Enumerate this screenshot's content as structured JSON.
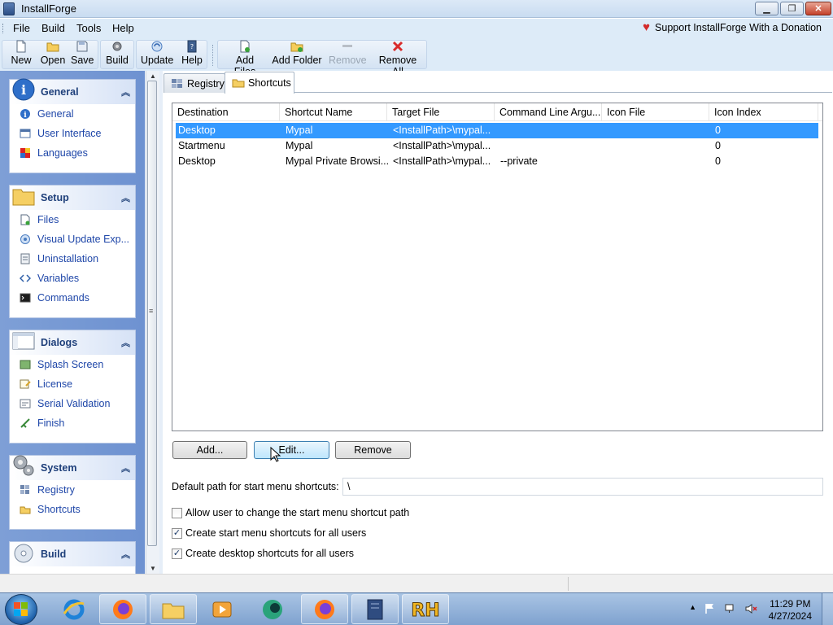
{
  "window": {
    "title": "InstallForge"
  },
  "menu": {
    "items": [
      "File",
      "Build",
      "Tools",
      "Help"
    ],
    "donation": "Support InstallForge With a Donation"
  },
  "toolbar": {
    "new": "New",
    "open": "Open",
    "save": "Save",
    "build": "Build",
    "update": "Update",
    "help": "Help",
    "add_files": "Add Files",
    "add_folder": "Add Folder",
    "remove": "Remove",
    "remove_all": "Remove All"
  },
  "sidebar": {
    "general": {
      "title": "General",
      "items": [
        "General",
        "User Interface",
        "Languages"
      ]
    },
    "setup": {
      "title": "Setup",
      "items": [
        "Files",
        "Visual Update Exp...",
        "Uninstallation",
        "Variables",
        "Commands"
      ]
    },
    "dialogs": {
      "title": "Dialogs",
      "items": [
        "Splash Screen",
        "License",
        "Serial Validation",
        "Finish"
      ]
    },
    "system": {
      "title": "System",
      "items": [
        "Registry",
        "Shortcuts"
      ]
    },
    "build": {
      "title": "Build"
    }
  },
  "tabs": {
    "registry": "Registry",
    "shortcuts": "Shortcuts"
  },
  "table": {
    "columns": [
      "Destination",
      "Shortcut Name",
      "Target File",
      "Command Line Argu...",
      "Icon File",
      "Icon Index"
    ],
    "rows": [
      [
        "Desktop",
        "Mypal",
        "<InstallPath>\\mypal...",
        "",
        "",
        "0"
      ],
      [
        "Startmenu",
        "Mypal",
        "<InstallPath>\\mypal...",
        "",
        "",
        "0"
      ],
      [
        "Desktop",
        "Mypal Private Browsi...",
        "<InstallPath>\\mypal...",
        "--private",
        "",
        "0"
      ]
    ]
  },
  "buttons": {
    "add": "Add...",
    "edit": "Edit...",
    "remove": "Remove"
  },
  "default_path": {
    "label": "Default path for start menu shortcuts:",
    "value": "\\"
  },
  "checkboxes": [
    {
      "label": "Allow user to change the start menu shortcut path",
      "checked": false
    },
    {
      "label": "Create start menu shortcuts for all users",
      "checked": true
    },
    {
      "label": "Create desktop shortcuts for all users",
      "checked": true
    }
  ],
  "taskbar": {
    "time": "11:29 PM",
    "date": "4/27/2024",
    "apps": [
      "internet-explorer",
      "firefox",
      "file-explorer",
      "media-player",
      "browser-green",
      "firefox",
      "installforge",
      "rh-app"
    ]
  }
}
